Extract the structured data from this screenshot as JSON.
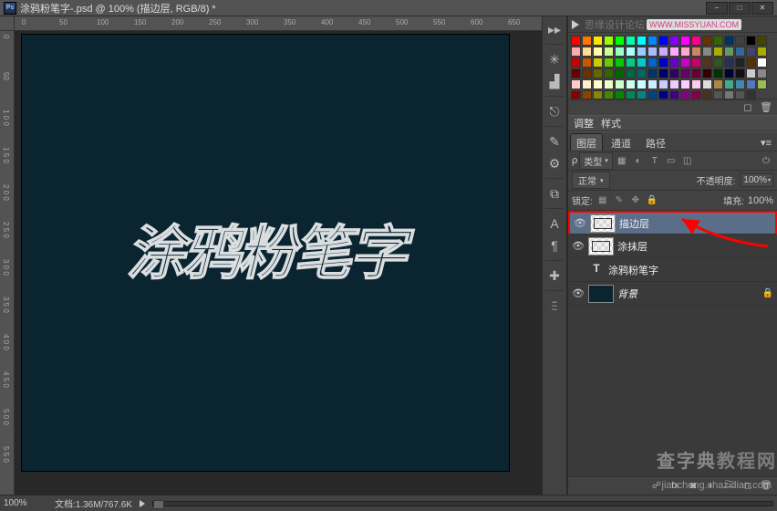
{
  "title": "涂鸦粉笔字-.psd @ 100% (描边层, RGB/8) *",
  "win_buttons": {
    "min": "−",
    "max": "□",
    "close": "✕"
  },
  "ruler_h": [
    "0",
    "50",
    "100",
    "150",
    "200",
    "250",
    "300",
    "350",
    "400",
    "450",
    "500",
    "550",
    "600",
    "650"
  ],
  "ruler_v": [
    "0",
    "50",
    "1 0 0",
    "1 5 0",
    "2 0 0",
    "2 5 0",
    "3 0 0",
    "3 5 0",
    "4 0 0",
    "4 5 0",
    "5 0 0",
    "5 5 0"
  ],
  "canvas_text": "涂鸦粉笔字",
  "swatches_header": {
    "forum_text": "思缘设计论坛",
    "forum_link": "WWW.MISSYUAN.COM"
  },
  "swatch_rows": [
    [
      "#ff0000",
      "#ff7700",
      "#ffe600",
      "#99ff00",
      "#00ff00",
      "#00ffaa",
      "#00ffff",
      "#0088ff",
      "#0000ff",
      "#8800ff",
      "#ff00ff",
      "#ff0088",
      "#663300",
      "#336600",
      "#003366",
      "#404040",
      "#000000",
      "#444400"
    ],
    [
      "#ffaaaa",
      "#ffdd99",
      "#ffffaa",
      "#ccff99",
      "#99ffcc",
      "#aaffff",
      "#99ccff",
      "#aabbff",
      "#ccaaff",
      "#ffaaff",
      "#ffaacc",
      "#cc8866",
      "#888888",
      "#aaaa00",
      "#669966",
      "#336699",
      "#444466",
      "#aaaa00"
    ],
    [
      "#cc0000",
      "#cc5500",
      "#cccc00",
      "#66cc00",
      "#00cc00",
      "#00cc88",
      "#00cccc",
      "#0066cc",
      "#0000cc",
      "#6600cc",
      "#cc00cc",
      "#cc0066",
      "#553322",
      "#335522",
      "#223355",
      "#222222",
      "#553300",
      "#ffffff"
    ],
    [
      "#660000",
      "#663300",
      "#666600",
      "#336600",
      "#006600",
      "#006644",
      "#006666",
      "#003366",
      "#000066",
      "#330066",
      "#660066",
      "#660033",
      "#330000",
      "#003300",
      "#000033",
      "#111111",
      "#cccccc",
      "#888888"
    ],
    [
      "#ffcccc",
      "#ffeecc",
      "#ffffcc",
      "#eeffcc",
      "#ccffcc",
      "#ccffee",
      "#ccffff",
      "#cceeff",
      "#ccccff",
      "#eeccff",
      "#ffccff",
      "#ffccee",
      "#dddddd",
      "#aa8844",
      "#44aa88",
      "#4488aa",
      "#5577bb",
      "#99bb55"
    ],
    [
      "#880000",
      "#884400",
      "#888800",
      "#448800",
      "#008800",
      "#008855",
      "#008888",
      "#004488",
      "#000088",
      "#440088",
      "#880088",
      "#880044",
      "#443322",
      "#555555",
      "#777777",
      "#555555",
      "#333333"
    ]
  ],
  "adjustments": {
    "tab1": "调整",
    "tab2": "样式"
  },
  "layers_tabs": {
    "layers": "图层",
    "channels": "通道",
    "paths": "路径"
  },
  "filter_row": {
    "label_icon": "ρ",
    "kind": "类型"
  },
  "blend_row": {
    "mode": "正常",
    "opacity_label": "不透明度:",
    "opacity_value": "100%"
  },
  "lock_row": {
    "label": "锁定:",
    "fill_label": "填充:",
    "fill_value": "100%"
  },
  "layers": [
    {
      "eye": true,
      "thumb": "checker",
      "name": "描边层",
      "selected": true,
      "highlight": true
    },
    {
      "eye": true,
      "thumb": "checker",
      "name": "涂抹层",
      "selected": false
    },
    {
      "eye": false,
      "thumb": "type",
      "type_glyph": "T",
      "name": "涂鸦粉笔字",
      "selected": false
    },
    {
      "eye": true,
      "thumb": "dark",
      "name": "背景",
      "italic": true,
      "locked": true,
      "selected": false
    }
  ],
  "status": {
    "zoom": "100%",
    "doc": "文档:1.36M/767.6K"
  },
  "watermarks": {
    "main_a": "查字典",
    "main_b": "教程网",
    "url": "jiaocheng.chazidian.com"
  }
}
